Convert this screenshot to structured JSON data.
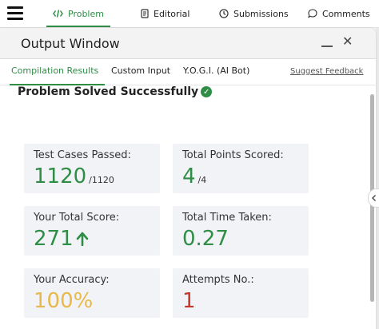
{
  "nav": {
    "tabs": [
      {
        "label": "Problem",
        "icon": "code-icon",
        "active": true
      },
      {
        "label": "Editorial",
        "icon": "document-icon",
        "active": false
      },
      {
        "label": "Submissions",
        "icon": "clock-icon",
        "active": false
      },
      {
        "label": "Comments",
        "icon": "comment-icon",
        "active": false
      }
    ]
  },
  "panel": {
    "title": "Output Window",
    "subtabs": [
      {
        "label": "Compilation Results",
        "active": true
      },
      {
        "label": "Custom Input",
        "active": false
      },
      {
        "label": "Y.O.G.I. (AI Bot)",
        "active": false
      }
    ],
    "feedback_link": "Suggest Feedback",
    "status": "Problem Solved Successfully",
    "cards": {
      "test_cases": {
        "label": "Test Cases Passed:",
        "value": "1120",
        "denominator": "/1120"
      },
      "points": {
        "label": "Total Points Scored:",
        "value": "4",
        "denominator": "/4"
      },
      "score": {
        "label": "Your Total Score:",
        "value": "271"
      },
      "time": {
        "label": "Total Time Taken:",
        "value": "0.27"
      },
      "accuracy": {
        "label": "Your Accuracy:",
        "value": "100%"
      },
      "attempts": {
        "label": "Attempts No.:",
        "value": "1"
      }
    }
  },
  "colors": {
    "accent": "#2f8d46",
    "yellow": "#e8b84a",
    "red": "#c7372c"
  }
}
